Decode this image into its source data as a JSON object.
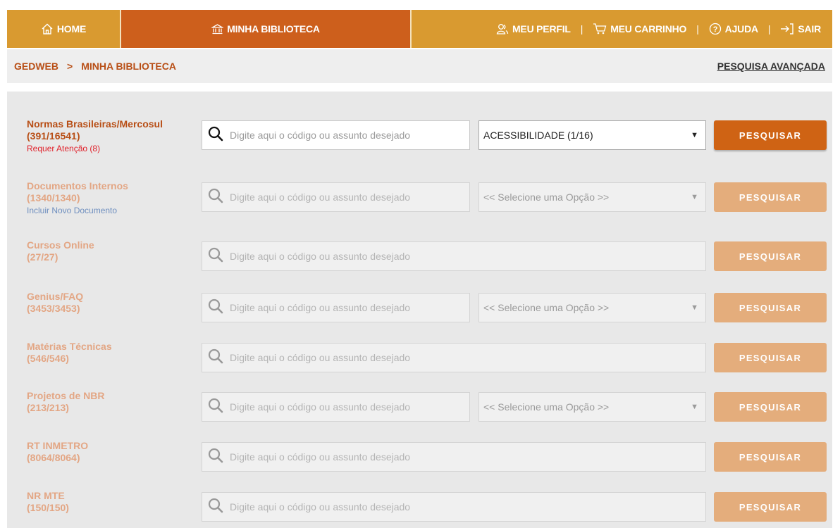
{
  "nav": {
    "home": "HOME",
    "library": "MINHA BIBLIOTECA",
    "profile": "MEU PERFIL",
    "cart": "MEU CARRINHO",
    "help": "AJUDA",
    "logout": "SAIR",
    "separator": "|"
  },
  "breadcrumb": {
    "root": "GEDWEB",
    "separator": ">",
    "current": "MINHA BIBLIOTECA",
    "advanced_search": "PESQUISA AVANÇADA"
  },
  "search_placeholder": "Digite aqui o código ou assunto desejado",
  "button_label": "PESQUISAR",
  "rows": [
    {
      "name": "Normas Brasileiras/Mercosul",
      "count": "(391/16541)",
      "sub": "Requer Atenção (8)",
      "select": "ACESSIBILIDADE (1/16)",
      "active": true
    },
    {
      "name": "Documentos Internos",
      "count": "(1340/1340)",
      "sub": "Incluir Novo Documento",
      "select": "<< Selecione uma Opção >>",
      "active": false
    },
    {
      "name": "Cursos Online",
      "count": "(27/27)",
      "active": false
    },
    {
      "name": "Genius/FAQ",
      "count": "(3453/3453)",
      "select": "<< Selecione uma Opção >>",
      "active": false
    },
    {
      "name": "Matérias Técnicas",
      "count": "(546/546)",
      "active": false
    },
    {
      "name": "Projetos de NBR",
      "count": "(213/213)",
      "select": "<< Selecione uma Opção >>",
      "active": false
    },
    {
      "name": "RT INMETRO",
      "count": "(8064/8064)",
      "active": false
    },
    {
      "name": "NR MTE",
      "count": "(150/150)",
      "active": false
    }
  ],
  "colors": {
    "nav_gold": "#d99a30",
    "nav_active": "#cd5f1c",
    "button_active": "#cf6314",
    "button_inactive": "#e4ad7c",
    "label_active": "#b84e15",
    "label_inactive": "#e3a684",
    "alert": "#e0202a",
    "link": "#6f8fbf"
  },
  "icons": {
    "home": "home-icon",
    "library": "bank-icon",
    "profile": "users-icon",
    "cart": "cart-icon",
    "help": "help-circle-icon",
    "logout": "logout-icon",
    "search": "search-icon",
    "select": "chevron-down-icon"
  }
}
